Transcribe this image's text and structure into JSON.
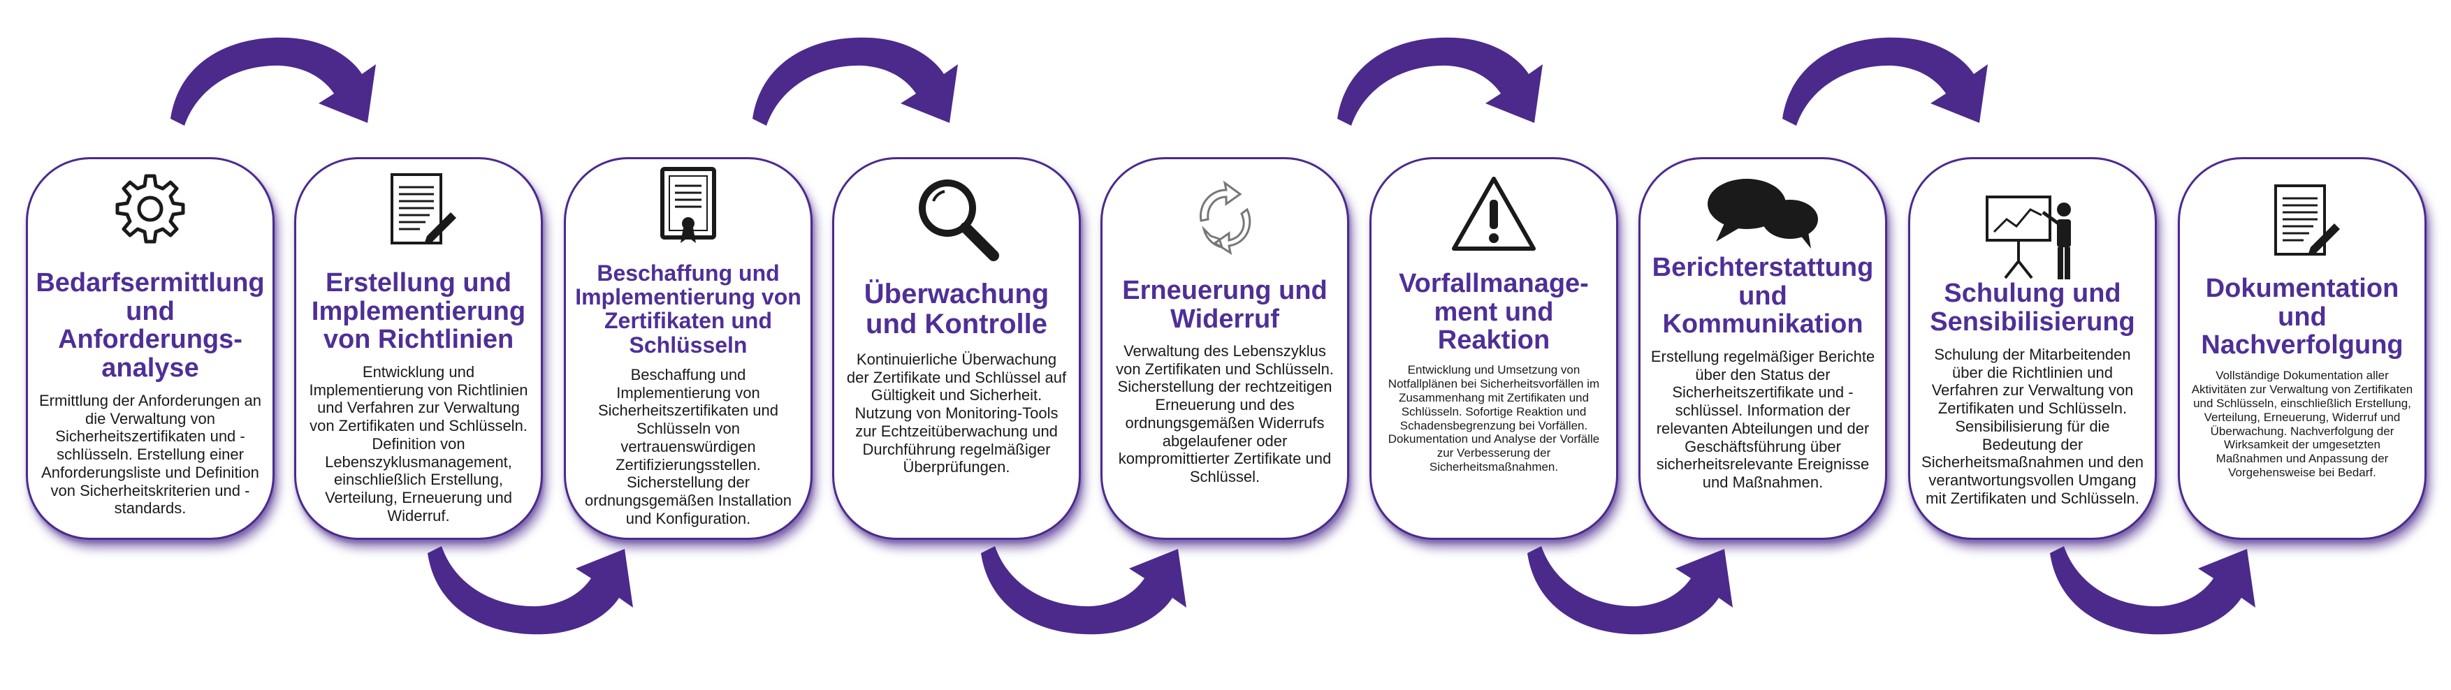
{
  "steps": [
    {
      "title": "Bedarfsermittlung und Anforderungs-analyse",
      "icon": "gear-icon",
      "text": "Ermittlung der Anforderungen an die Verwaltung von Sicherheitszertifikaten und -schlüsseln. Erstellung einer Anforderungsliste und Definition von Sicherheitskriterien und -standards."
    },
    {
      "title": "Erstellung und Implementierung von Richtlinien",
      "icon": "document-pen-icon",
      "text": "Entwicklung und Implementierung von Richtlinien und Verfahren zur Verwaltung von Zertifikaten und Schlüsseln. Definition von Lebenszyklusmanagement, einschließlich Erstellung, Verteilung, Erneuerung und Widerruf."
    },
    {
      "title": "Beschaffung und Implementierung von Zertifikaten und Schlüsseln",
      "icon": "certificate-icon",
      "text": "Beschaffung und Implementierung von Sicherheitszertifikaten und Schlüsseln von vertrauenswürdigen Zertifizierungsstellen. Sicherstellung der ordnungsgemäßen Installation und Konfiguration."
    },
    {
      "title": "Überwachung und Kontrolle",
      "icon": "magnifier-icon",
      "text": "Kontinuierliche Überwachung der Zertifikate und Schlüssel auf Gültigkeit und Sicherheit. Nutzung von Monitoring-Tools zur Echtzeitüberwachung und Durchführung regelmäßiger Überprüfungen."
    },
    {
      "title": "Erneuerung und Widerruf",
      "icon": "recycle-arrows-icon",
      "text": "Verwaltung des Lebenszyklus von Zertifikaten und Schlüsseln. Sicherstellung der rechtzeitigen Erneuerung und des ordnungsgemäßen Widerrufs abgelaufener oder kompromittierter Zertifikate und Schlüssel."
    },
    {
      "title": "Vorfallmanage-ment und Reaktion",
      "icon": "warning-icon",
      "text": "Entwicklung und Umsetzung von Notfallplänen bei Sicherheitsvorfällen im Zusammenhang mit Zertifikaten und Schlüsseln. Sofortige Reaktion und Schadensbegrenzung bei Vorfällen. Dokumentation und Analyse der Vorfälle zur Verbesserung der Sicherheitsmaßnahmen."
    },
    {
      "title": "Berichterstattung und Kommunikation",
      "icon": "speech-bubbles-icon",
      "text": "Erstellung regelmäßiger Berichte über den Status der Sicherheitszertifikate und -schlüssel. Information der relevanten Abteilungen und der Geschäftsführung über sicherheitsrelevante Ereignisse und Maßnahmen."
    },
    {
      "title": "Schulung und Sensibilisierung",
      "icon": "presenter-board-icon",
      "text": "Schulung der Mitarbeitenden über die Richtlinien und Verfahren zur Verwaltung von Zertifikaten und Schlüsseln. Sensibilisierung für die Bedeutung der Sicherheitsmaßnahmen und den verantwortungsvollen Umgang mit Zertifikaten und Schlüsseln."
    },
    {
      "title": "Dokumentation und Nachverfolgung",
      "icon": "document-pen-icon",
      "text": "Vollständige Dokumentation aller Aktivitäten zur Verwaltung von Zertifikaten und Schlüsseln, einschließlich Erstellung, Verteilung, Erneuerung, Widerruf und Überwachung. Nachverfolgung der Wirksamkeit der umgesetzten Maßnahmen und Anpassung der Vorgehensweise bei Bedarf."
    }
  ],
  "colors": {
    "accent": "#4f2f96",
    "border": "#4b2a8c",
    "arrow": "#4b2a8c"
  }
}
